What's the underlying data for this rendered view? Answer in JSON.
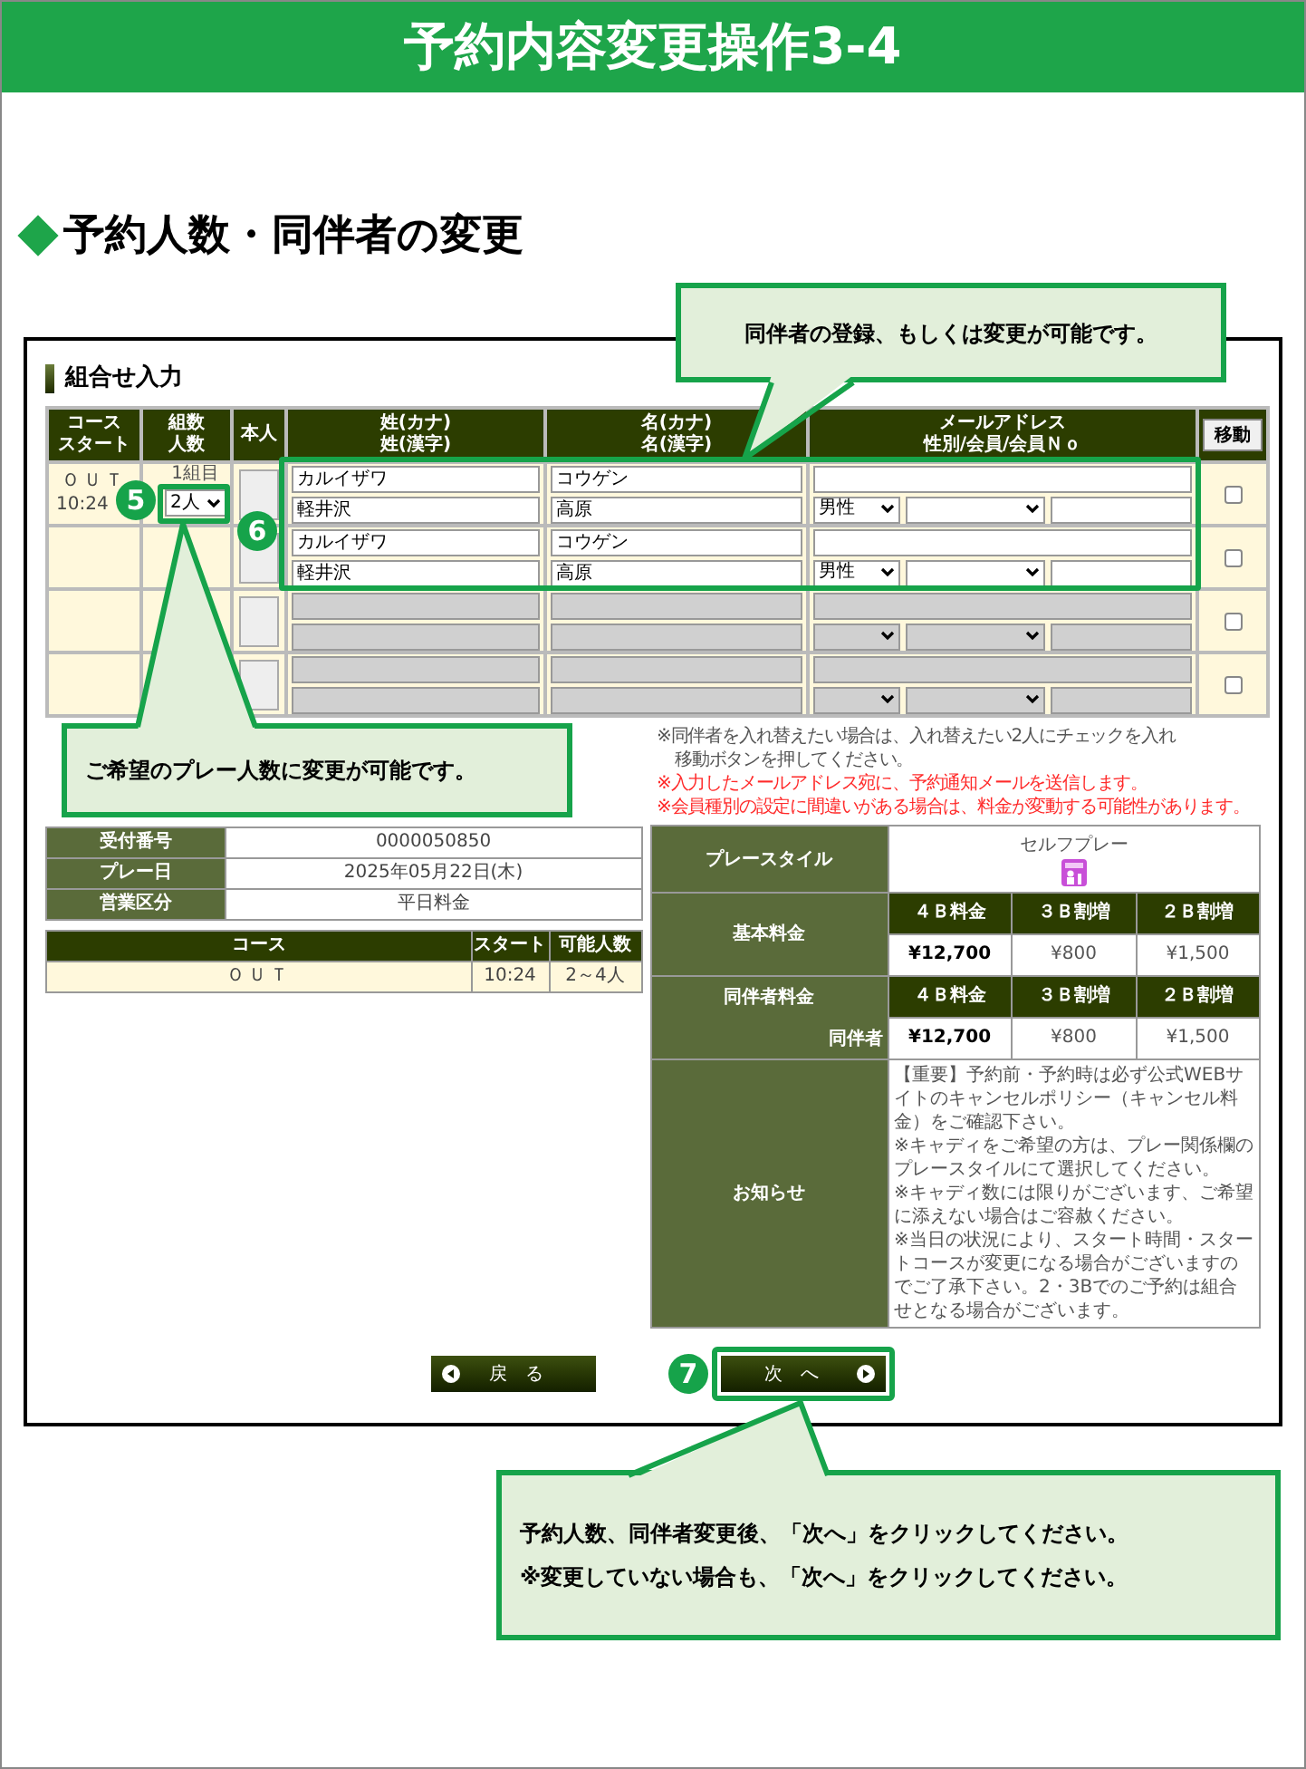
{
  "header": {
    "title": "予約内容変更操作3-4"
  },
  "section": {
    "title": "予約人数・同伴者の変更"
  },
  "form": {
    "title": "組合せ入力",
    "columns": [
      {
        "lines": [
          "コース",
          "スタート"
        ]
      },
      {
        "lines": [
          "組数",
          "人数"
        ]
      },
      {
        "lines": [
          "本人"
        ]
      },
      {
        "lines": [
          "姓(カナ)",
          "姓(漢字)"
        ]
      },
      {
        "lines": [
          "名(カナ)",
          "名(漢字)"
        ]
      },
      {
        "lines": [
          "メールアドレス",
          "性別/会員/会員Ｎｏ"
        ]
      }
    ],
    "move_button": "移動",
    "rows": [
      {
        "enabled": true,
        "course": "ＯＵＴ",
        "start": "10:24",
        "group": "1組目",
        "party_size": "2人",
        "sei_kana": "カルイザワ",
        "sei_kanji": "軽井沢",
        "mei_kana": "コウゲン",
        "mei_kanji": "高原",
        "gender": "男性",
        "checked": false
      },
      {
        "enabled": true,
        "sei_kana": "カルイザワ",
        "sei_kanji": "軽井沢",
        "mei_kana": "コウゲン",
        "mei_kanji": "高原",
        "gender": "男性",
        "checked": false
      },
      {
        "enabled": false,
        "checked": false
      },
      {
        "enabled": false,
        "checked": false
      }
    ]
  },
  "notes": [
    {
      "kind": "info",
      "text": "※同伴者を入れ替えたい場合は、入れ替えたい2人にチェックを入れ"
    },
    {
      "kind": "info",
      "text": "移動ボタンを押してください。"
    },
    {
      "kind": "warning",
      "text": "※入力したメールアドレス宛に、予約通知メールを送信します。"
    },
    {
      "kind": "warning",
      "text": "※会員種別の設定に間違いがある場合は、料金が変動する可能性があります。"
    }
  ],
  "reservation": [
    {
      "label": "受付番号",
      "value": "0000050850"
    },
    {
      "label": "プレー日",
      "value": "2025年05月22日(木)"
    },
    {
      "label": "営業区分",
      "value": "平日料金"
    }
  ],
  "course_table": {
    "columns": [
      "コース",
      "スタート",
      "可能人数"
    ],
    "rows": [
      [
        "ＯＵＴ",
        "10:24",
        "2～4人"
      ]
    ]
  },
  "pricing": {
    "play_style": {
      "label": "プレースタイル",
      "value": "セルフプレー"
    },
    "fees": [
      {
        "label": "基本料金",
        "headers": [
          "４Ｂ料金",
          "３Ｂ割増",
          "２Ｂ割増"
        ],
        "values": [
          "¥12,700",
          "¥800",
          "¥1,500"
        ]
      },
      {
        "label": "同伴者料金",
        "sublabel": "同伴者",
        "headers": [
          "４Ｂ料金",
          "３Ｂ割増",
          "２Ｂ割増"
        ],
        "values": [
          "¥12,700",
          "¥800",
          "¥1,500"
        ]
      }
    ],
    "notice": {
      "label": "お知らせ",
      "paragraphs": [
        "【重要】予約前・予約時は必ず公式WEBサイトのキャンセルポリシー（キャンセル料金）をご確認下さい。",
        "※キャディをご希望の方は、プレー関係欄のプレースタイルにて選択してください。",
        "※キャディ数には限りがございます、ご希望に添えない場合はご容赦ください。",
        "※当日の状況により、スタート時間・スタートコースが変更になる場合がございますのでご了承下さい。2・3Bでのご予約は組合せとなる場合がございます。"
      ]
    }
  },
  "buttons": [
    {
      "kind": "back",
      "label": "戻　る",
      "highlighted": false
    },
    {
      "kind": "next",
      "label": "次　へ",
      "highlighted": true
    }
  ],
  "callouts": {
    "companions": {
      "text": "同伴者の登録、もしくは変更が可能です。"
    },
    "party_size": {
      "text": "ご希望のプレー人数に変更が可能です。"
    },
    "next": {
      "lines": [
        "予約人数、同伴者変更後、「次へ」をクリックしてください。",
        "※変更していない場合も、「次へ」をクリックしてください。"
      ]
    }
  },
  "markers": {
    "party_size": "5",
    "companions": "6",
    "next": "7"
  }
}
